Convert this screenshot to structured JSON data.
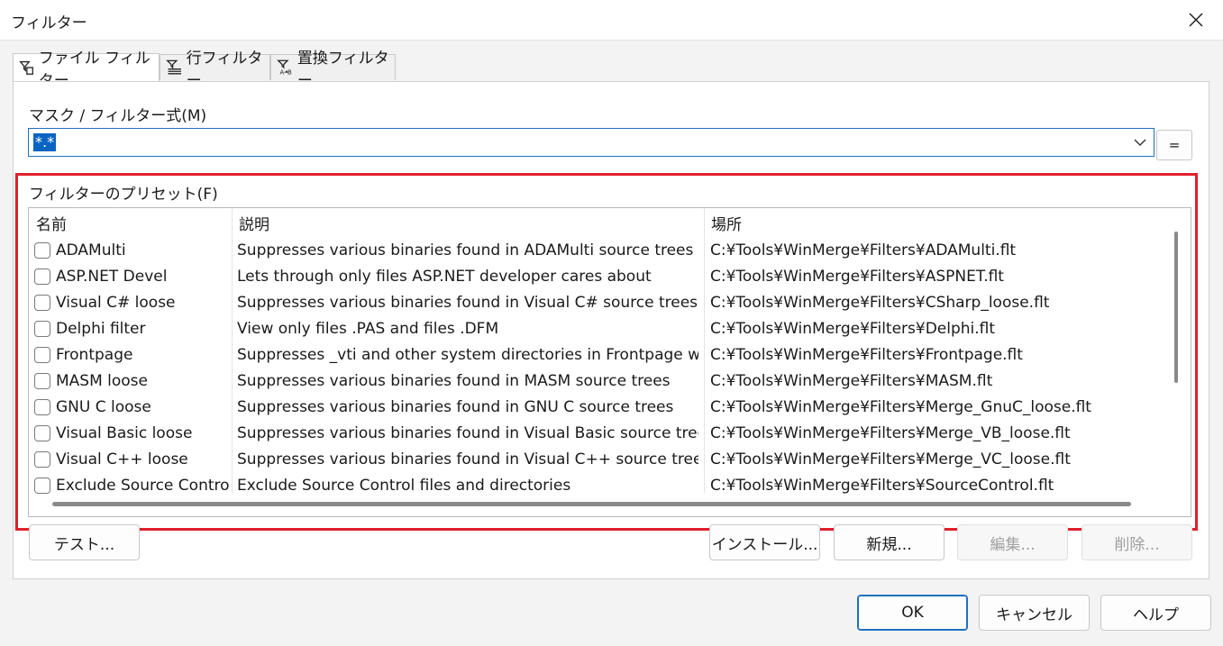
{
  "window": {
    "title": "フィルター"
  },
  "icons": {
    "close": "close-icon",
    "dropdown": "chevron-down-icon",
    "file_filter": "file-filter-icon",
    "line_filter": "line-filter-icon",
    "replace_filter": "replace-filter-icon"
  },
  "tabs": [
    {
      "label": "ファイル フィルター"
    },
    {
      "label": "行フィルター"
    },
    {
      "label": "置換フィルター"
    }
  ],
  "mask": {
    "label": "マスク / フィルター式(M)",
    "value": "*.*",
    "menu_button": "="
  },
  "presets": {
    "label": "フィルターのプリセット(F)",
    "columns": [
      "名前",
      "説明",
      "場所"
    ],
    "rows": [
      {
        "name": "ADAMulti",
        "desc": "Suppresses various binaries found in ADAMulti source trees",
        "path": "C:¥Tools¥WinMerge¥Filters¥ADAMulti.flt"
      },
      {
        "name": "ASP.NET Devel",
        "desc": "Lets through only files ASP.NET developer cares about",
        "path": "C:¥Tools¥WinMerge¥Filters¥ASPNET.flt"
      },
      {
        "name": "Visual C# loose",
        "desc": "Suppresses various binaries found in Visual C# source trees",
        "path": "C:¥Tools¥WinMerge¥Filters¥CSharp_loose.flt"
      },
      {
        "name": "Delphi filter",
        "desc": "View only files .PAS and files .DFM",
        "path": "C:¥Tools¥WinMerge¥Filters¥Delphi.flt"
      },
      {
        "name": "Frontpage",
        "desc": "Suppresses _vti and other system directories in Frontpage web...",
        "path": "C:¥Tools¥WinMerge¥Filters¥Frontpage.flt"
      },
      {
        "name": "MASM loose",
        "desc": "Suppresses various binaries found in MASM source trees",
        "path": "C:¥Tools¥WinMerge¥Filters¥MASM.flt"
      },
      {
        "name": "GNU C loose",
        "desc": "Suppresses various binaries found in GNU C source trees",
        "path": "C:¥Tools¥WinMerge¥Filters¥Merge_GnuC_loose.flt"
      },
      {
        "name": "Visual Basic loose",
        "desc": "Suppresses various binaries found in Visual Basic source trees",
        "path": "C:¥Tools¥WinMerge¥Filters¥Merge_VB_loose.flt"
      },
      {
        "name": "Visual C++ loose",
        "desc": "Suppresses various binaries found in Visual C++ source trees",
        "path": "C:¥Tools¥WinMerge¥Filters¥Merge_VC_loose.flt"
      },
      {
        "name": "Exclude Source Control",
        "desc": "Exclude Source Control files and directories",
        "path": "C:¥Tools¥WinMerge¥Filters¥SourceControl.flt"
      }
    ]
  },
  "buttons": {
    "test": "テスト...",
    "install": "インストール...",
    "new": "新規...",
    "edit": "編集...",
    "delete": "削除...",
    "ok": "OK",
    "cancel": "キャンセル",
    "help": "ヘルプ"
  }
}
